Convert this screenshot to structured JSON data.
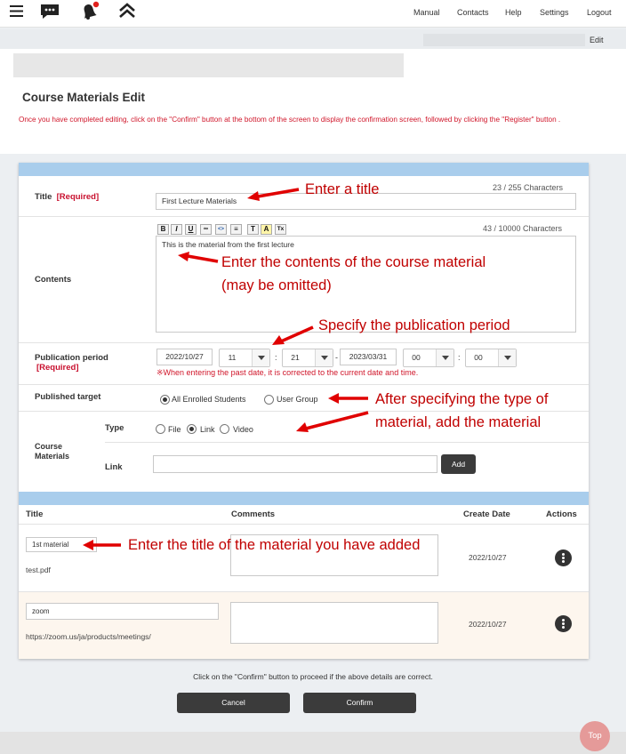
{
  "nav": {
    "links": [
      "Manual",
      "Contacts",
      "Help",
      "Settings",
      "Logout"
    ]
  },
  "breadcrumb": {
    "current": "Edit"
  },
  "page": {
    "title": "Course Materials Edit",
    "instruction": "Once you have completed editing, click on the \"Confirm\" button at the bottom of the screen to display the confirmation screen, followed by clicking the \"Register\" button ."
  },
  "form": {
    "title_label": "Title",
    "title_required": "[Required]",
    "title_value": "First Lecture Materials",
    "title_count": "23 / 255 Characters",
    "contents_label": "Contents",
    "contents_count": "43 / 10000 Characters",
    "contents_value": "This is the material from the first lecture",
    "toolbar": [
      "B",
      "I",
      "U",
      "∞",
      "<>",
      "≡",
      "≡",
      "T",
      "A",
      "Tx"
    ],
    "period_label": "Publication period",
    "period_required": "[Required]",
    "start_date": "2022/10/27",
    "start_hour": "11",
    "start_min": "21",
    "end_date": "2023/03/31",
    "end_hour": "00",
    "end_min": "00",
    "dash": "-",
    "colon": ":",
    "period_note": "※When entering the past date, it is corrected to the current date and time.",
    "target_label": "Published target",
    "target_options": [
      "All Enrolled Students",
      "User Group"
    ],
    "materials_label": "Course Materials",
    "type_label": "Type",
    "type_options": [
      "File",
      "Link",
      "Video"
    ],
    "link_label": "Link",
    "add_button": "Add"
  },
  "annotations": {
    "title": "Enter a title",
    "contents_line1": "Enter the contents of the course material",
    "contents_line2": "(may be omitted)",
    "period": "Specify the publication period",
    "type_line1": "After specifying the type of",
    "type_line2": "material, add the material",
    "material_title": "Enter the title of the material you have added"
  },
  "table": {
    "headers": [
      "Title",
      "Comments",
      "Create Date",
      "Actions"
    ],
    "rows": [
      {
        "title": "1st material",
        "file": "test.pdf",
        "date": "2022/10/27"
      },
      {
        "title": "zoom",
        "file": "https://zoom.us/ja/products/meetings/",
        "date": "2022/10/27"
      }
    ]
  },
  "footer": {
    "note": "Click on the \"Confirm\" button to proceed if the above details are correct.",
    "cancel": "Cancel",
    "confirm": "Confirm",
    "top": "Top"
  },
  "colors": {
    "accent": "#c00000",
    "required": "#c8102e",
    "bar": "#a9cdec",
    "button": "#3b3b3b"
  },
  "icons": [
    "menu-icon",
    "chat-icon",
    "bell-icon",
    "chevron-up-icon",
    "chevron-down-icon",
    "more-vertical-icon"
  ]
}
